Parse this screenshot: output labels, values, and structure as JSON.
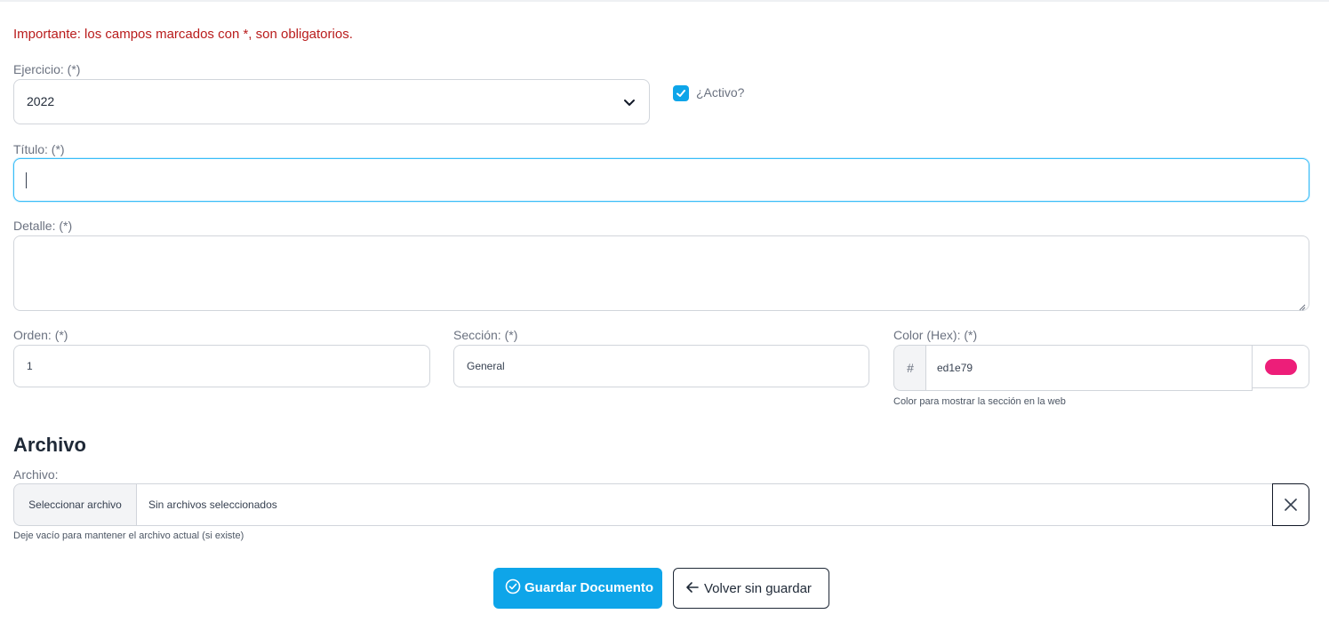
{
  "notice": "Importante: los campos marcados con *, son obligatorios.",
  "ejercicio": {
    "label": "Ejercicio: (*)",
    "value": "2022"
  },
  "activo": {
    "label": "¿Activo?",
    "checked": true
  },
  "titulo": {
    "label": "Título: (*)",
    "value": ""
  },
  "detalle": {
    "label": "Detalle: (*)",
    "value": ""
  },
  "orden": {
    "label": "Orden: (*)",
    "value": "1"
  },
  "seccion": {
    "label": "Sección: (*)",
    "value": "General"
  },
  "color": {
    "label": "Color (Hex): (*)",
    "prefix": "#",
    "value": "ed1e79",
    "swatch": "#ed1e79",
    "help": "Color para mostrar la sección en la web"
  },
  "archivo_section": {
    "title": "Archivo"
  },
  "archivo": {
    "label": "Archivo:",
    "button": "Seleccionar archivo",
    "status": "Sin archivos seleccionados",
    "help": "Deje vacío para mantener el archivo actual (si existe)"
  },
  "actions": {
    "save": "Guardar Documento",
    "back": "Volver sin guardar"
  },
  "colors": {
    "accent": "#0ea5e9",
    "notice": "#b91c1c"
  }
}
